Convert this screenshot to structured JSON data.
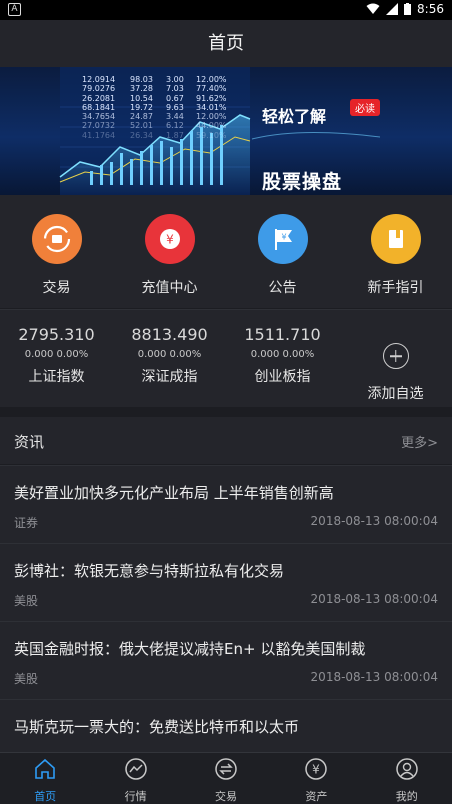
{
  "status_bar": {
    "time": "8:56"
  },
  "header": {
    "title": "首页"
  },
  "banner": {
    "top_text": "轻松了解",
    "badge": "必读",
    "main_text": "股票操盘",
    "ticker_rows": [
      [
        "12.0914",
        "98.03",
        "3.00",
        "12.00%"
      ],
      [
        "79.0276",
        "37.28",
        "7.03",
        "77.40%"
      ],
      [
        "26.2081",
        "10.54",
        "0.67",
        "91.62%"
      ],
      [
        "68.1841",
        "19.72",
        "9.63",
        "34.01%"
      ],
      [
        "34.7654",
        "24.87",
        "3.44",
        "12.00%"
      ],
      [
        "27.0732",
        "52.01",
        "6.12",
        "44.00%"
      ],
      [
        "41.1764",
        "26.34",
        "1.87",
        "59.10%"
      ]
    ]
  },
  "quick_menu": [
    {
      "label": "交易",
      "icon": "exchange-icon",
      "color": "#f0803a"
    },
    {
      "label": "充值中心",
      "icon": "yuan-icon",
      "color": "#e8343a"
    },
    {
      "label": "公告",
      "icon": "flag-icon",
      "color": "#3e9be8"
    },
    {
      "label": "新手指引",
      "icon": "book-icon",
      "color": "#f2b22a"
    }
  ],
  "indices": [
    {
      "value": "2795.310",
      "change": "0.000  0.00%",
      "name": "上证指数"
    },
    {
      "value": "8813.490",
      "change": "0.000  0.00%",
      "name": "深证成指"
    },
    {
      "value": "1511.710",
      "change": "0.000  0.00%",
      "name": "创业板指"
    }
  ],
  "add_watchlist": {
    "label": "添加自选"
  },
  "news": {
    "title": "资讯",
    "more": "更多>",
    "items": [
      {
        "title": "美好置业加快多元化产业布局 上半年销售创新高",
        "category": "证券",
        "time": "2018-08-13 08:00:04"
      },
      {
        "title": "彭博社：软银无意参与特斯拉私有化交易",
        "category": "美股",
        "time": "2018-08-13 08:00:04"
      },
      {
        "title": "英国金融时报：俄大佬提议减持En+ 以豁免美国制裁",
        "category": "美股",
        "time": "2018-08-13 08:00:04"
      },
      {
        "title": "马斯克玩一票大的：免费送比特币和以太币",
        "category": "",
        "time": ""
      }
    ]
  },
  "tab_bar": [
    {
      "label": "首页",
      "icon": "home-icon",
      "active": true
    },
    {
      "label": "行情",
      "icon": "chart-icon",
      "active": false
    },
    {
      "label": "交易",
      "icon": "exchange-icon",
      "active": false
    },
    {
      "label": "资产",
      "icon": "yuan-icon",
      "active": false
    },
    {
      "label": "我的",
      "icon": "user-icon",
      "active": false
    }
  ],
  "colors": {
    "accent": "#2e9cf5",
    "background": "#1c1d22",
    "panel": "#24252b"
  }
}
